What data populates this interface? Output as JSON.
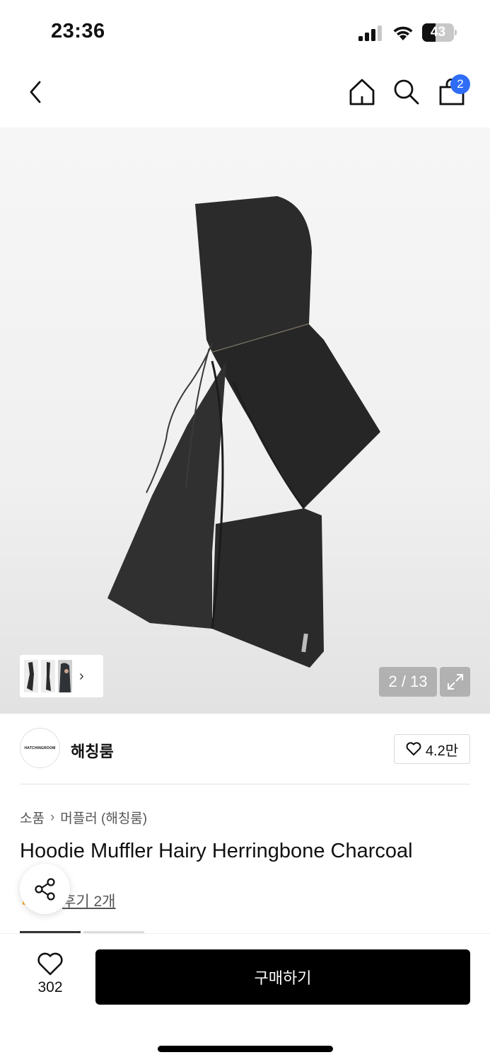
{
  "status_bar": {
    "time": "23:36",
    "battery_level": "43",
    "battery_fraction": 0.43
  },
  "header": {
    "cart_count": "2",
    "icons": [
      "back-icon",
      "home-icon",
      "search-icon",
      "shopping-bag-icon"
    ]
  },
  "gallery": {
    "page_counter": "2 / 13",
    "colors": {
      "fabric": "#2a2a2a",
      "background": "#f2f2f2"
    }
  },
  "brand": {
    "logo_text": "HATCHINGROOM",
    "name": "해칭룸",
    "like_count": "4.2만"
  },
  "product": {
    "breadcrumb": [
      "소품",
      "머플러 (해칭룸)"
    ],
    "title": "Hoodie Muffler Hairy Herringbone Charcoal",
    "review_text": "후기 2개"
  },
  "bottom_bar": {
    "wish_count": "302",
    "buy_label": "구매하기"
  },
  "colors": {
    "accent_badge": "#2f6df6",
    "buy_button": "#000000"
  }
}
